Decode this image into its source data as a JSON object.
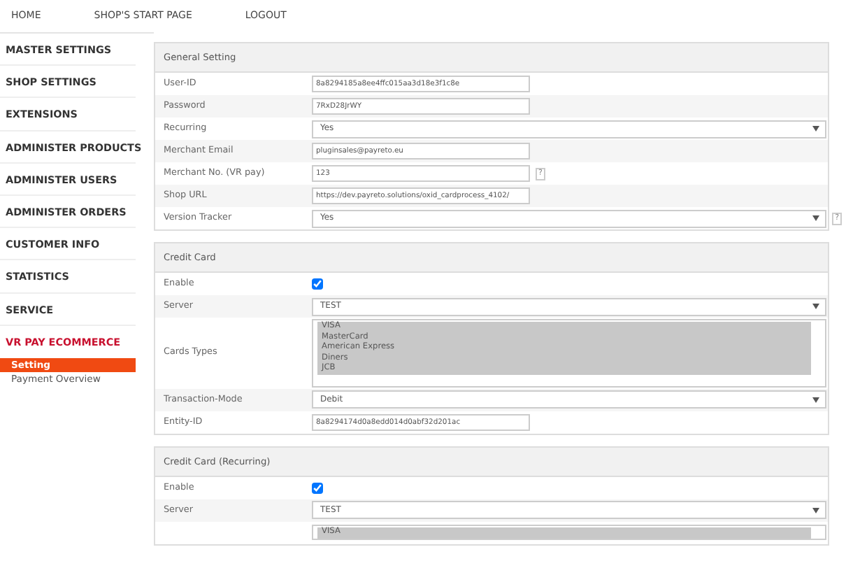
{
  "top_nav": [
    {
      "label": "HOME"
    },
    {
      "label": "SHOP'S START PAGE"
    },
    {
      "label": "LOGOUT"
    }
  ],
  "sidebar": {
    "items": [
      {
        "label": "MASTER SETTINGS",
        "expanded": false
      },
      {
        "label": "SHOP SETTINGS",
        "expanded": false
      },
      {
        "label": "EXTENSIONS",
        "expanded": false
      },
      {
        "label": "ADMINISTER PRODUCTS",
        "expanded": false
      },
      {
        "label": "ADMINISTER USERS",
        "expanded": false
      },
      {
        "label": "ADMINISTER ORDERS",
        "expanded": false
      },
      {
        "label": "CUSTOMER INFO",
        "expanded": false
      },
      {
        "label": "STATISTICS",
        "expanded": false
      },
      {
        "label": "SERVICE",
        "expanded": false
      },
      {
        "label": "VR PAY ECOMMERCE",
        "expanded": true,
        "children": [
          {
            "label": "Setting",
            "selected": true
          },
          {
            "label": "Payment Overview",
            "selected": false
          }
        ]
      }
    ]
  },
  "sections": [
    {
      "title": "General Setting",
      "rows": [
        {
          "kind": "text",
          "label": "User-ID",
          "value": "8a8294185a8ee4ffc015aa3d18e3f1c8e"
        },
        {
          "kind": "text",
          "label": "Password",
          "value": "7RxD28JrWY"
        },
        {
          "kind": "select",
          "label": "Recurring",
          "value": "Yes"
        },
        {
          "kind": "text",
          "label": "Merchant Email",
          "value": "pluginsales@payreto.eu"
        },
        {
          "kind": "text",
          "label": "Merchant No. (VR pay)",
          "value": "123",
          "help": "?"
        },
        {
          "kind": "text",
          "label": "Shop URL",
          "value": "https://dev.payreto.solutions/oxid_cardprocess_4102/"
        },
        {
          "kind": "select",
          "label": "Version Tracker",
          "value": "Yes",
          "help": "?"
        }
      ]
    },
    {
      "title": "Credit Card",
      "rows": [
        {
          "kind": "checkbox",
          "label": "Enable",
          "checked": true
        },
        {
          "kind": "select",
          "label": "Server",
          "value": "TEST"
        },
        {
          "kind": "multiselect",
          "label": "Cards Types",
          "options": [
            {
              "label": "VISA",
              "selected": true
            },
            {
              "label": "MasterCard",
              "selected": true
            },
            {
              "label": "American Express",
              "selected": true
            },
            {
              "label": "Diners",
              "selected": true
            },
            {
              "label": "JCB",
              "selected": true
            }
          ]
        },
        {
          "kind": "select",
          "label": "Transaction-Mode",
          "value": "Debit"
        },
        {
          "kind": "text",
          "label": "Entity-ID",
          "value": "8a8294174d0a8edd014d0abf32d201ac"
        }
      ]
    },
    {
      "title": "Credit Card (Recurring)",
      "rows": [
        {
          "kind": "checkbox",
          "label": "Enable",
          "checked": true
        },
        {
          "kind": "select",
          "label": "Server",
          "value": "TEST"
        },
        {
          "kind": "multiselect",
          "options": [
            {
              "label": "VISA",
              "selected": true
            }
          ]
        }
      ]
    }
  ]
}
